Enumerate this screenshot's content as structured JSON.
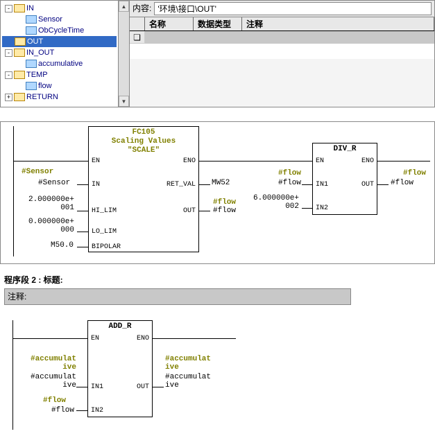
{
  "pathbar": {
    "label": "内容:",
    "value": "'环境\\接口\\OUT'"
  },
  "grid": {
    "headers": [
      "",
      "名称",
      "数据类型",
      "注释"
    ],
    "marker": "❏"
  },
  "tree": {
    "in": "IN",
    "sensor": "Sensor",
    "obcycle": "ObCycleTime",
    "out": "OUT",
    "inout": "IN_OUT",
    "acc": "accumulative",
    "temp": "TEMP",
    "flow": "flow",
    "return": "RETURN"
  },
  "fc105": {
    "title": "FC105",
    "subtitle1": "Scaling Values",
    "subtitle2": "\"SCALE\"",
    "en": "EN",
    "eno": "ENO",
    "in": "IN",
    "retval": "RET_VAL",
    "hilim": "HI_LIM",
    "out": "OUT",
    "lolim": "LO_LIM",
    "bipolar": "BIPOLAR",
    "sensor_sym": "#Sensor",
    "sensor_val": "#Sensor",
    "hi_val": "2.000000e+\n001",
    "lo_val": "0.000000e+\n000",
    "bip_val": "M50.0",
    "retval_out": "MW52",
    "out_sym": "#flow",
    "out_val": "#flow"
  },
  "divr": {
    "title": "DIV_R",
    "en": "EN",
    "eno": "ENO",
    "in1": "IN1",
    "in2": "IN2",
    "out": "OUT",
    "in1_sym": "#flow",
    "in1_val": "#flow",
    "in2_val": "6.000000e+\n002",
    "out_sym": "#flow",
    "out_val": "#flow"
  },
  "seg2": {
    "header": "程序段 2 : 标题:",
    "comment": "注释:"
  },
  "addr": {
    "title": "ADD_R",
    "en": "EN",
    "eno": "ENO",
    "in1": "IN1",
    "in2": "IN2",
    "out": "OUT",
    "in1_sym": "#accumulat\nive",
    "in1_val": "#accumulat\nive",
    "in2_sym": "#flow",
    "in2_val": "#flow",
    "out_sym": "#accumulat\nive",
    "out_val": "#accumulat\nive"
  }
}
